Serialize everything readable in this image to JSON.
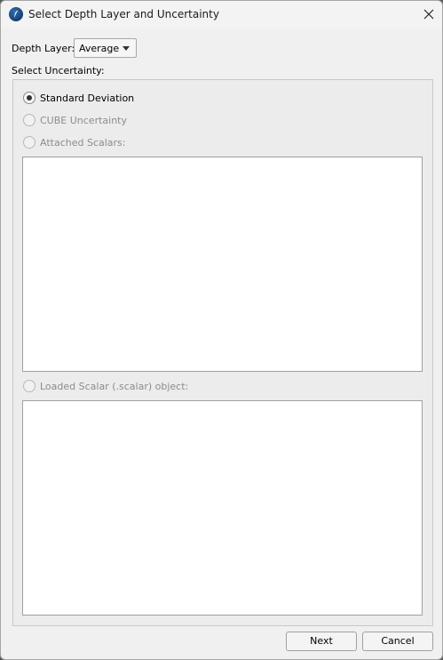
{
  "window": {
    "title": "Select Depth Layer and Uncertainty",
    "app_icon": "app-logo-icon",
    "close_icon": "close-icon"
  },
  "depth_layer": {
    "label": "Depth Layer:",
    "selected": "Average"
  },
  "uncertainty": {
    "label": "Select Uncertainty:",
    "options": [
      {
        "label": "Standard Deviation",
        "selected": true,
        "enabled": true
      },
      {
        "label": "CUBE Uncertainty",
        "selected": false,
        "enabled": false
      },
      {
        "label": "Attached Scalars:",
        "selected": false,
        "enabled": false
      },
      {
        "label": "Loaded Scalar (.scalar) object:",
        "selected": false,
        "enabled": false
      }
    ]
  },
  "buttons": {
    "next": "Next",
    "cancel": "Cancel"
  }
}
